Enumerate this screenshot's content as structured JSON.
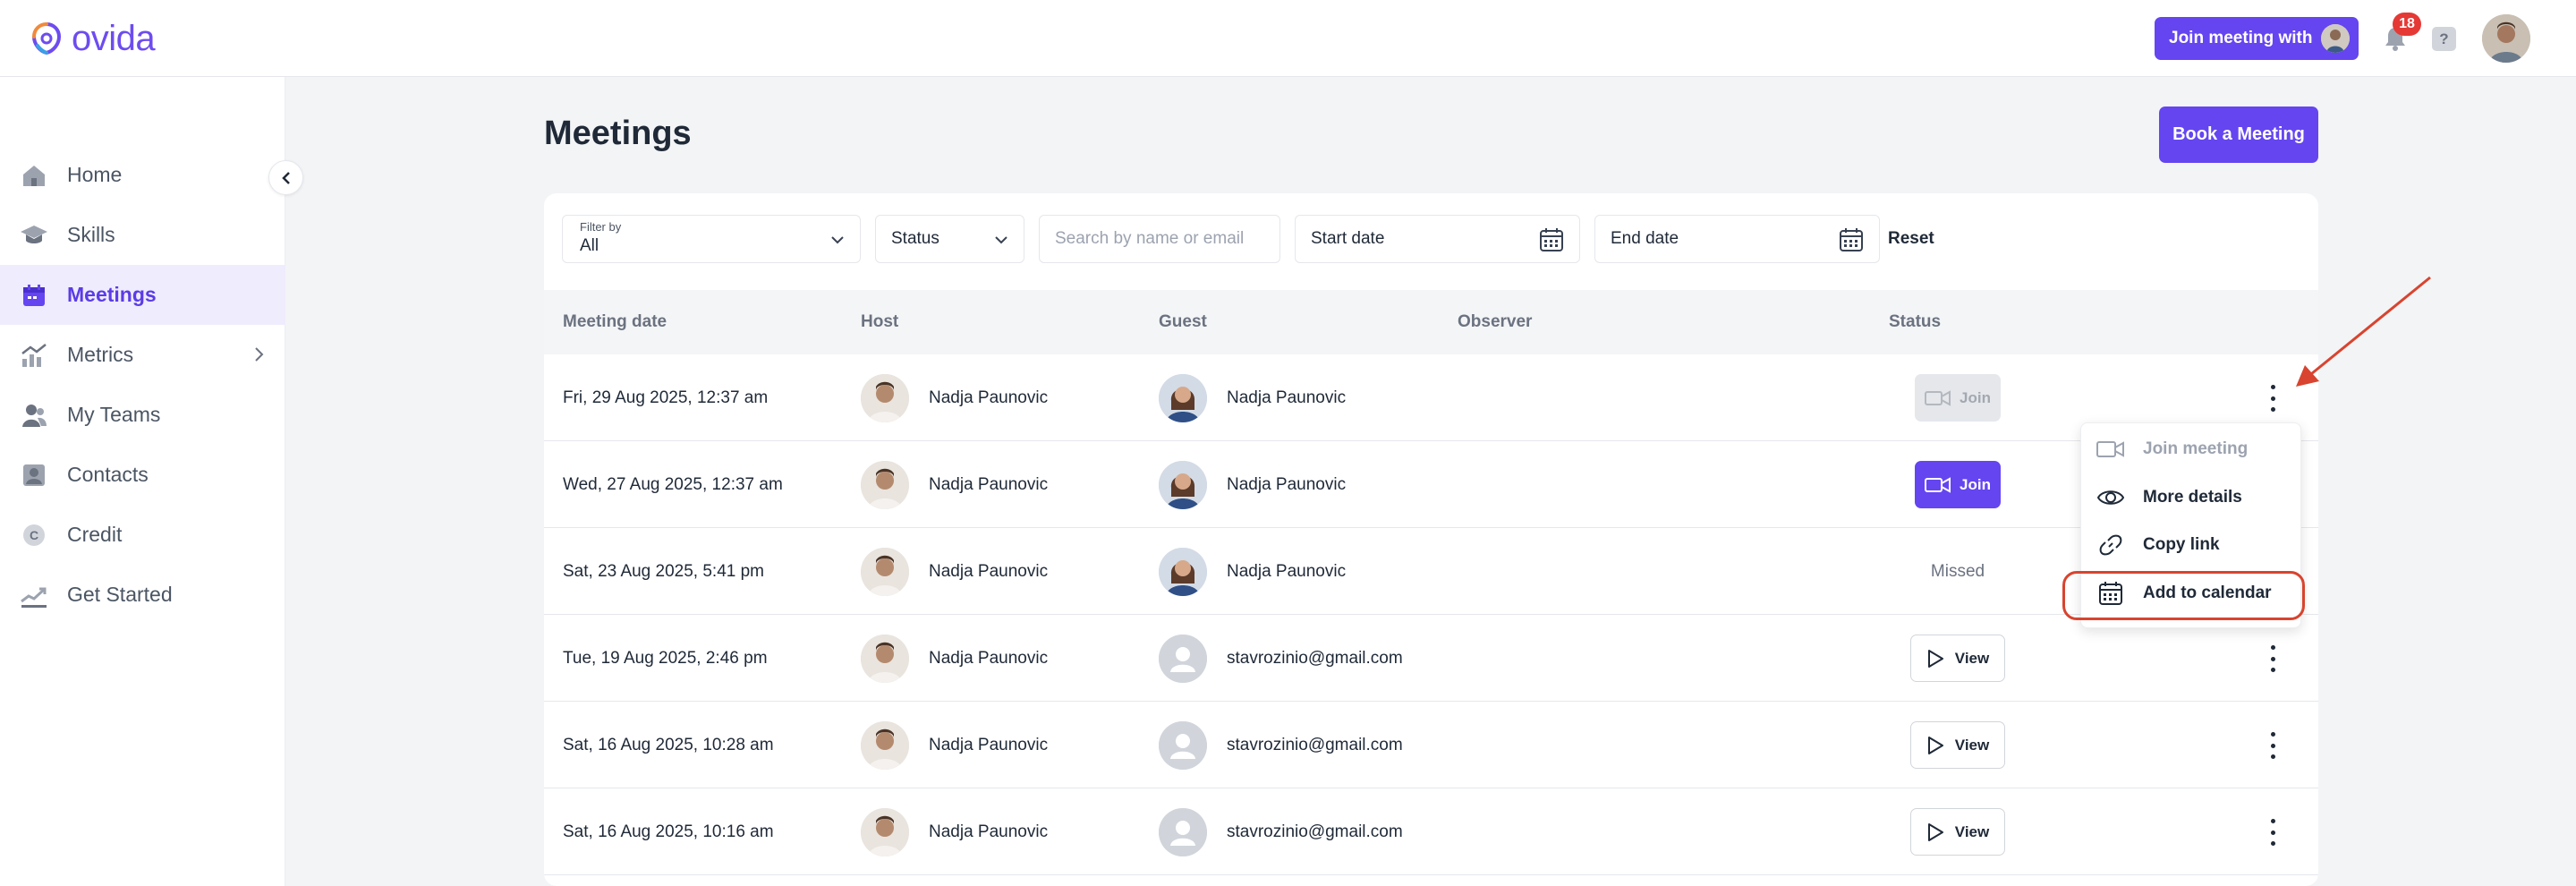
{
  "app": {
    "brand": "ovida"
  },
  "topbar": {
    "join_with_label": "Join meeting with",
    "notification_count": "18",
    "help_label": "?"
  },
  "sidebar": {
    "items": [
      {
        "label": "Home",
        "icon": "home-icon",
        "active": false
      },
      {
        "label": "Skills",
        "icon": "graduation-cap-icon",
        "active": false
      },
      {
        "label": "Meetings",
        "icon": "calendar-icon",
        "active": true
      },
      {
        "label": "Metrics",
        "icon": "chart-icon",
        "active": false,
        "has_submenu": true
      },
      {
        "label": "My Teams",
        "icon": "team-icon",
        "active": false
      },
      {
        "label": "Contacts",
        "icon": "contacts-icon",
        "active": false
      },
      {
        "label": "Credit",
        "icon": "credit-coin-icon",
        "active": false
      },
      {
        "label": "Get Started",
        "icon": "get-started-icon",
        "active": false
      }
    ]
  },
  "main": {
    "title": "Meetings",
    "book_label": "Book a Meeting",
    "filters": {
      "filter_by_label": "Filter by",
      "filter_by_value": "All",
      "status_label": "Status",
      "search_placeholder": "Search by name or email",
      "start_date_placeholder": "Start date",
      "end_date_placeholder": "End date",
      "reset_label": "Reset"
    },
    "columns": [
      "Meeting date",
      "Host",
      "Guest",
      "Observer",
      "Status"
    ],
    "rows": [
      {
        "date": "Fri, 29 Aug 2025, 12:37 am",
        "host": "Nadja Paunovic",
        "guest": "Nadja Paunovic",
        "guest_photo": true,
        "status": "join-disabled",
        "status_label": "Join"
      },
      {
        "date": "Wed, 27 Aug 2025, 12:37 am",
        "host": "Nadja Paunovic",
        "guest": "Nadja Paunovic",
        "guest_photo": true,
        "status": "join",
        "status_label": "Join"
      },
      {
        "date": "Sat, 23 Aug 2025, 5:41 pm",
        "host": "Nadja Paunovic",
        "guest": "Nadja Paunovic",
        "guest_photo": true,
        "status": "missed",
        "status_label": "Missed"
      },
      {
        "date": "Tue, 19 Aug 2025, 2:46 pm",
        "host": "Nadja Paunovic",
        "guest": "stavrozinio@gmail.com",
        "guest_photo": false,
        "status": "view",
        "status_label": "View"
      },
      {
        "date": "Sat, 16 Aug 2025, 10:28 am",
        "host": "Nadja Paunovic",
        "guest": "stavrozinio@gmail.com",
        "guest_photo": false,
        "status": "view",
        "status_label": "View"
      },
      {
        "date": "Sat, 16 Aug 2025, 10:16 am",
        "host": "Nadja Paunovic",
        "guest": "stavrozinio@gmail.com",
        "guest_photo": false,
        "status": "view",
        "status_label": "View"
      }
    ]
  },
  "row_menu": {
    "items": [
      {
        "label": "Join meeting",
        "icon": "video-camera-icon",
        "disabled": true
      },
      {
        "label": "More details",
        "icon": "eye-icon",
        "disabled": false
      },
      {
        "label": "Copy link",
        "icon": "link-icon",
        "disabled": false
      },
      {
        "label": "Add to calendar",
        "icon": "calendar-add-icon",
        "disabled": false,
        "highlighted": true
      }
    ]
  },
  "colors": {
    "accent": "#6545f0",
    "active_nav_bg": "#efecfd",
    "annotation": "#d8442f",
    "badge": "#e53935"
  }
}
